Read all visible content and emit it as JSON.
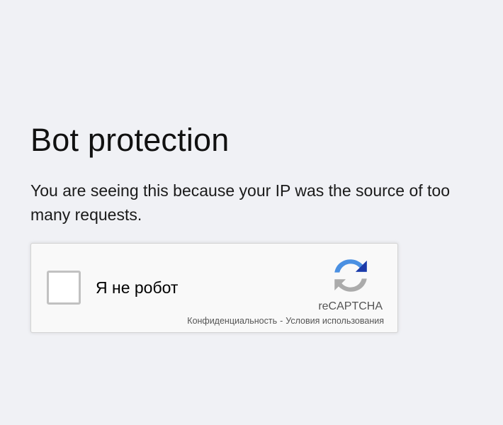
{
  "page": {
    "title": "Bot protection",
    "description": "You are seeing this because your IP was the source of too many requests."
  },
  "captcha": {
    "checkbox_label": "Я не робот",
    "brand": "reCAPTCHA",
    "privacy_link": "Конфиденциальность",
    "separator": "-",
    "terms_link": "Условия использования",
    "logo_icon": "recaptcha-logo-icon",
    "checkbox_checked": false
  }
}
